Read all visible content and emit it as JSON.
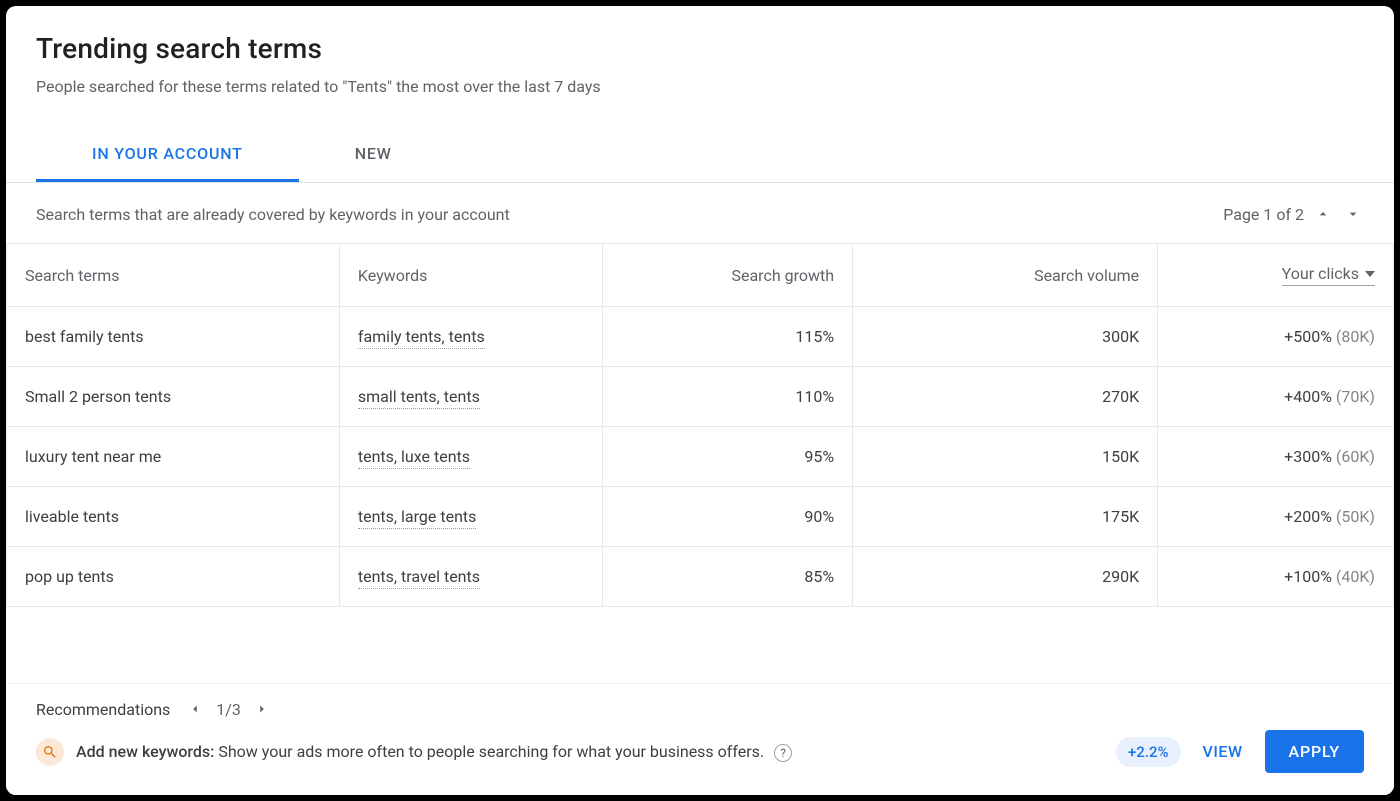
{
  "header": {
    "title": "Trending search terms",
    "subtitle": "People searched for these terms related to \"Tents\" the most over the last 7 days"
  },
  "tabs": {
    "in_account": "IN YOUR ACCOUNT",
    "new": "NEW"
  },
  "meta": {
    "description": "Search terms that are already covered by keywords in your account",
    "page_label": "Page 1 of 2"
  },
  "table": {
    "headers": {
      "search_terms": "Search terms",
      "keywords": "Keywords",
      "search_growth": "Search growth",
      "search_volume": "Search volume",
      "your_clicks": "Your clicks"
    },
    "rows": [
      {
        "term": "best family tents",
        "keywords": "family tents, tents",
        "growth": "115%",
        "volume": "300K",
        "clicks_delta": "+500%",
        "clicks_abs": "(80K)"
      },
      {
        "term": "Small 2 person tents",
        "keywords": "small tents, tents",
        "growth": "110%",
        "volume": "270K",
        "clicks_delta": "+400%",
        "clicks_abs": "(70K)"
      },
      {
        "term": "luxury tent near me",
        "keywords": "tents, luxe tents",
        "growth": "95%",
        "volume": "150K",
        "clicks_delta": "+300%",
        "clicks_abs": "(60K)"
      },
      {
        "term": "liveable tents",
        "keywords": "tents, large tents",
        "growth": "90%",
        "volume": "175K",
        "clicks_delta": "+200%",
        "clicks_abs": "(50K)"
      },
      {
        "term": "pop up tents",
        "keywords": "tents, travel tents",
        "growth": "85%",
        "volume": "290K",
        "clicks_delta": "+100%",
        "clicks_abs": "(40K)"
      }
    ]
  },
  "footer": {
    "rec_label": "Recommendations",
    "rec_page": "1/3",
    "rec_title": "Add new keywords:",
    "rec_desc": " Show your ads more often to people searching for what your business offers.",
    "uplift": "+2.2%",
    "view": "VIEW",
    "apply": "APPLY"
  }
}
